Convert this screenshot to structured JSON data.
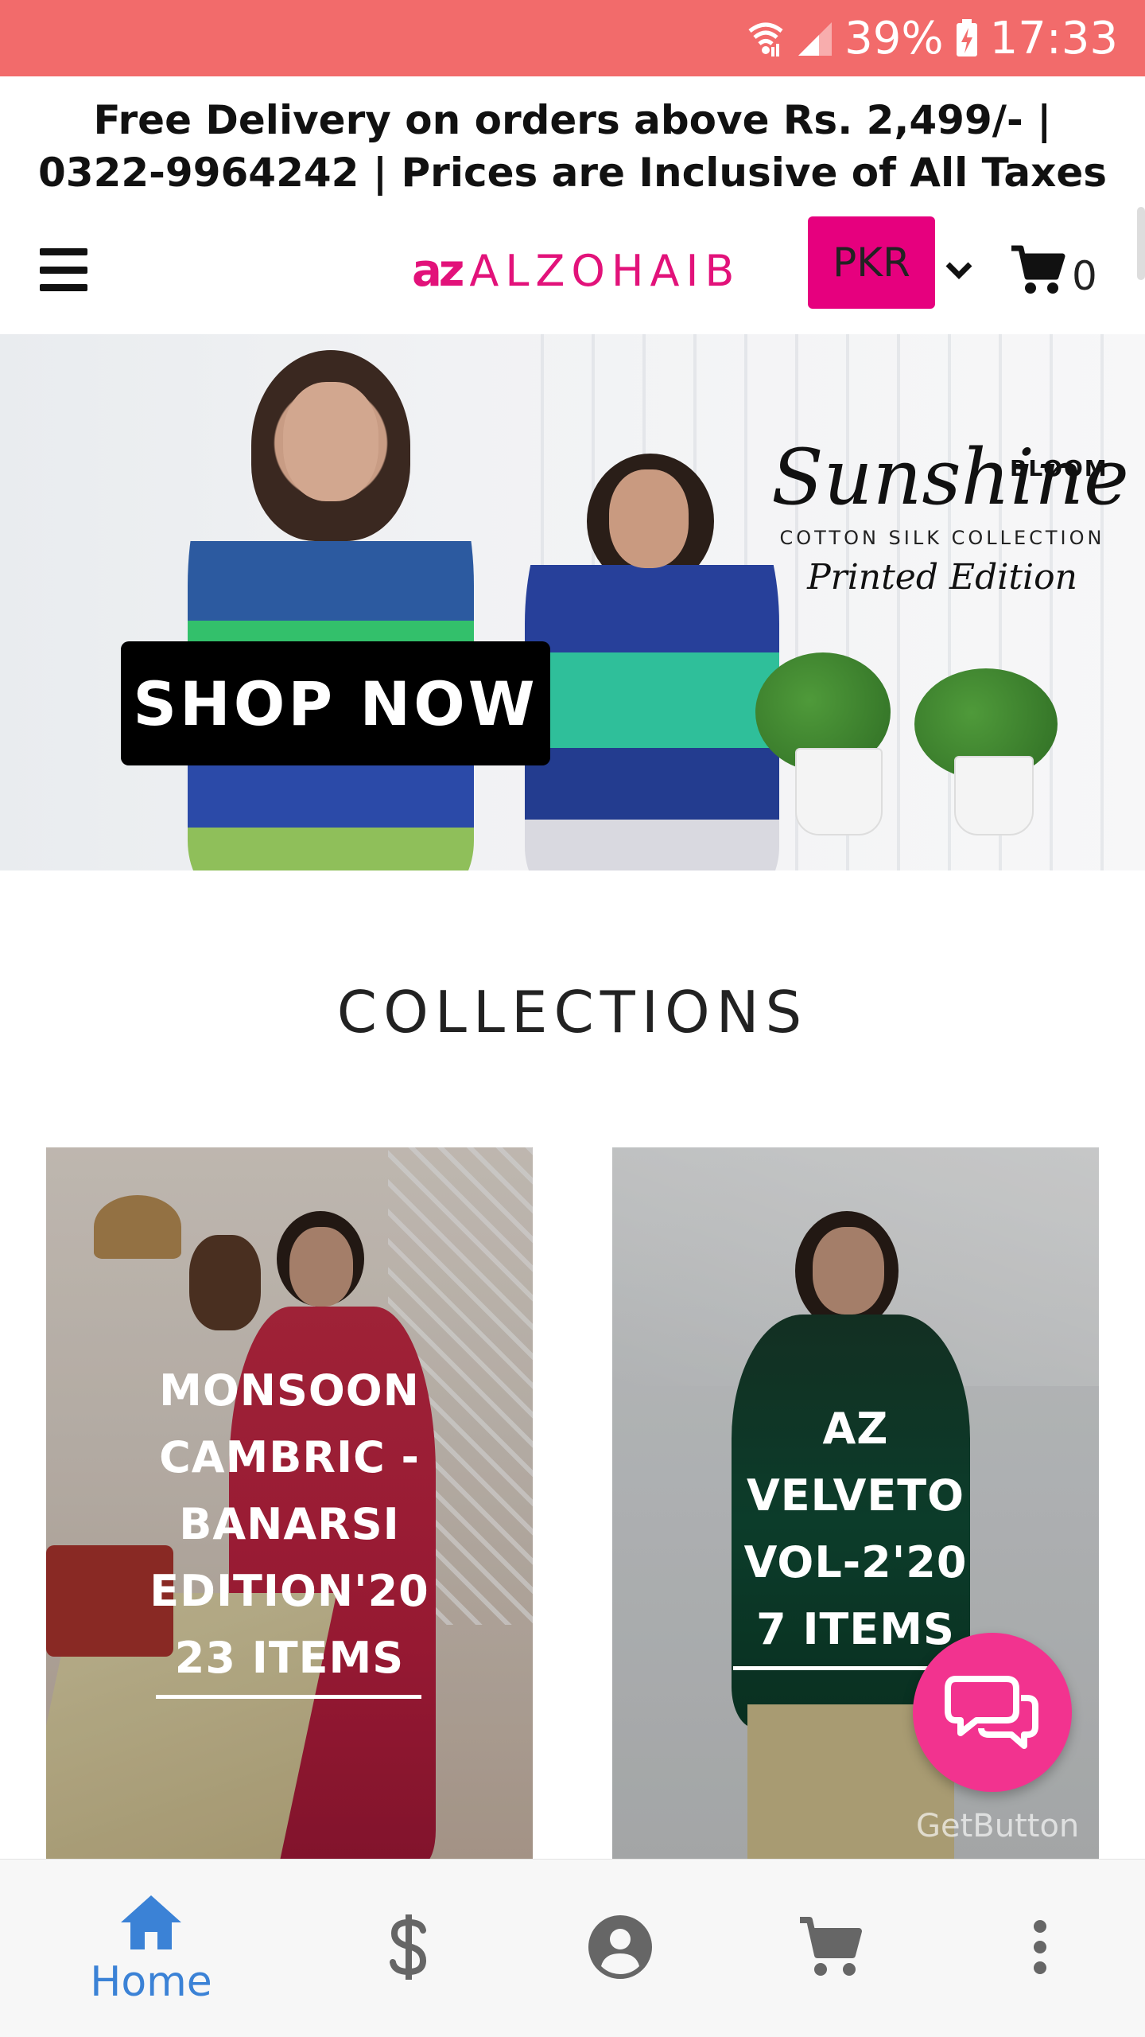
{
  "status_bar": {
    "battery": "39%",
    "time": "17:33",
    "color": "#f26b6b"
  },
  "promo": {
    "text": "Free Delivery on orders above Rs. 2,499/- | 0322-9964242 | Prices are Inclusive of All Taxes"
  },
  "header": {
    "logo_mark": "az",
    "logo_text": "ALZOHAIB",
    "currency": "PKR",
    "cart_count": "0",
    "brand_color": "#e6007e"
  },
  "hero": {
    "bloom": "BLOOM",
    "title": "Sunshine",
    "subtitle": "COTTON SILK COLLECTION",
    "edition": "Printed Edition",
    "cta": "SHOP NOW"
  },
  "collections": {
    "heading": "COLLECTIONS",
    "items": [
      {
        "lines": [
          "MONSOON",
          "CAMBRIC -",
          "BANARSI",
          "EDITION'20",
          "23 ITEMS"
        ]
      },
      {
        "lines": [
          "AZ",
          "VELVETO",
          "VOL-2'20",
          "7 ITEMS"
        ]
      }
    ]
  },
  "chat": {
    "watermark": "GetButton",
    "color": "#f2338f"
  },
  "bottom_nav": {
    "items": [
      {
        "label": "Home",
        "icon": "home-icon",
        "active": true
      },
      {
        "label": "",
        "icon": "dollar-icon"
      },
      {
        "label": "",
        "icon": "account-icon"
      },
      {
        "label": "",
        "icon": "cart-icon"
      },
      {
        "label": "",
        "icon": "more-vertical-icon"
      }
    ],
    "active_color": "#3b82d6"
  }
}
